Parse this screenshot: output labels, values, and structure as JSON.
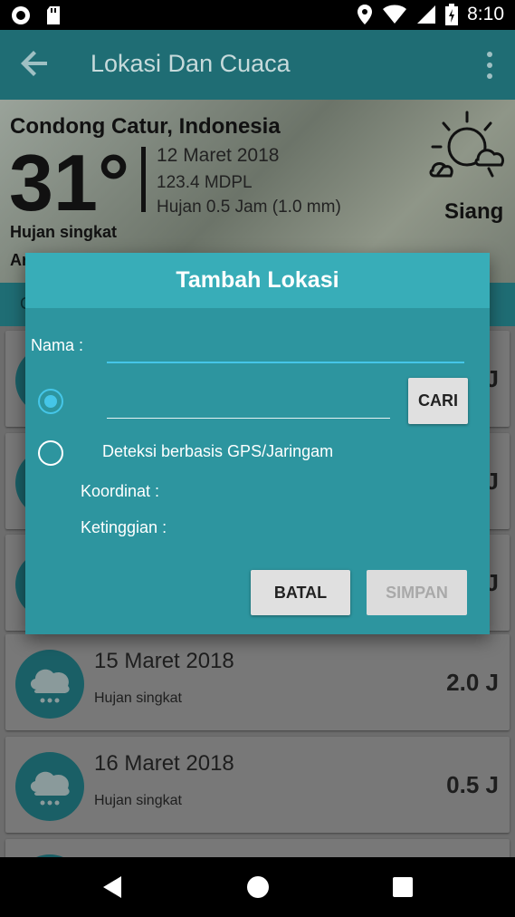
{
  "status_bar": {
    "time": "8:10"
  },
  "app_bar": {
    "title": "Lokasi Dan Cuaca"
  },
  "weather": {
    "location": "Condong Catur, Indonesia",
    "temperature": "31°",
    "date": "12 Maret 2018",
    "elevation": "123.4 MDPL",
    "rain": "Hujan 0.5 Jam (1.0 mm)",
    "description": "Hujan singkat",
    "truncated_line": "Ar",
    "period": "Siang"
  },
  "tab_strip": {
    "visible_char": "C"
  },
  "list": {
    "items": [
      {
        "date": "",
        "summary": "",
        "duration": "J"
      },
      {
        "date": "",
        "summary": "",
        "duration": "J"
      },
      {
        "date": "",
        "summary": "",
        "duration": "J"
      },
      {
        "date": "15 Maret 2018",
        "summary": "Hujan singkat",
        "duration": "2.0 J"
      },
      {
        "date": "16 Maret 2018",
        "summary": "Hujan singkat",
        "duration": "0.5 J"
      }
    ]
  },
  "dialog": {
    "title": "Tambah Lokasi",
    "name_label": "Nama :",
    "name_value": "",
    "address_value": "",
    "search_button": "CARI",
    "gps_option": "Deteksi berbasis GPS/Jaringam",
    "coordinate_label": "Koordinat :",
    "elevation_label": "Ketinggian :",
    "cancel_button": "BATAL",
    "save_button": "SIMPAN",
    "selected_option": "manual"
  },
  "colors": {
    "app_bar": "#1f6d74",
    "dialog_header": "#38adb8",
    "dialog_body": "#2d959f",
    "accent": "#45c6e8"
  }
}
